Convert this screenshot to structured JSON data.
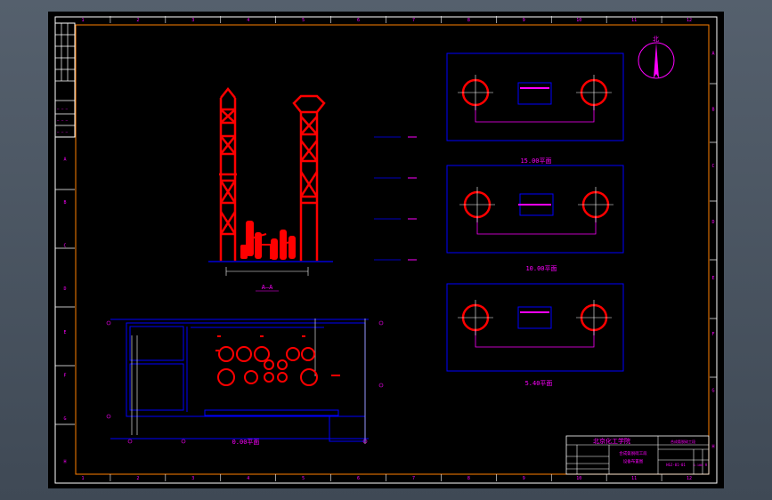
{
  "drawing": {
    "views": {
      "plan_0": "0.00平面",
      "plan_5": "5.40平面",
      "plan_10": "10.00平面",
      "plan_15": "15.00平面",
      "section": "A—A"
    },
    "north_label": "北",
    "title_block": {
      "school": "北京化工学院",
      "project": "合成氨脱硫工段",
      "drawing_title_line1": "合成氨脱硫工段",
      "drawing_title_line2": "设备布置图",
      "drawing_number": "HGJ-01-01",
      "sheet_mark": "A",
      "spec": "1:100"
    },
    "top_ruler": [
      "1",
      "2",
      "3",
      "4",
      "5",
      "6",
      "7",
      "8",
      "9",
      "10",
      "11",
      "12"
    ],
    "bottom_ruler": [
      "1",
      "2",
      "3",
      "4",
      "5",
      "6",
      "7",
      "8",
      "9",
      "10",
      "11",
      "12"
    ],
    "left_ruler": [
      "A",
      "B",
      "C",
      "D",
      "E",
      "F",
      "G",
      "H"
    ],
    "right_ruler": [
      "A",
      "B",
      "C",
      "D",
      "E",
      "F",
      "G",
      "H"
    ],
    "colors": {
      "background": "#000000",
      "frame": "#ffffff",
      "border": "#ff8000",
      "equipment": "#ff0000",
      "structure": "#0000ff",
      "text": "#ff00ff",
      "centerline": "#ffffff"
    }
  }
}
